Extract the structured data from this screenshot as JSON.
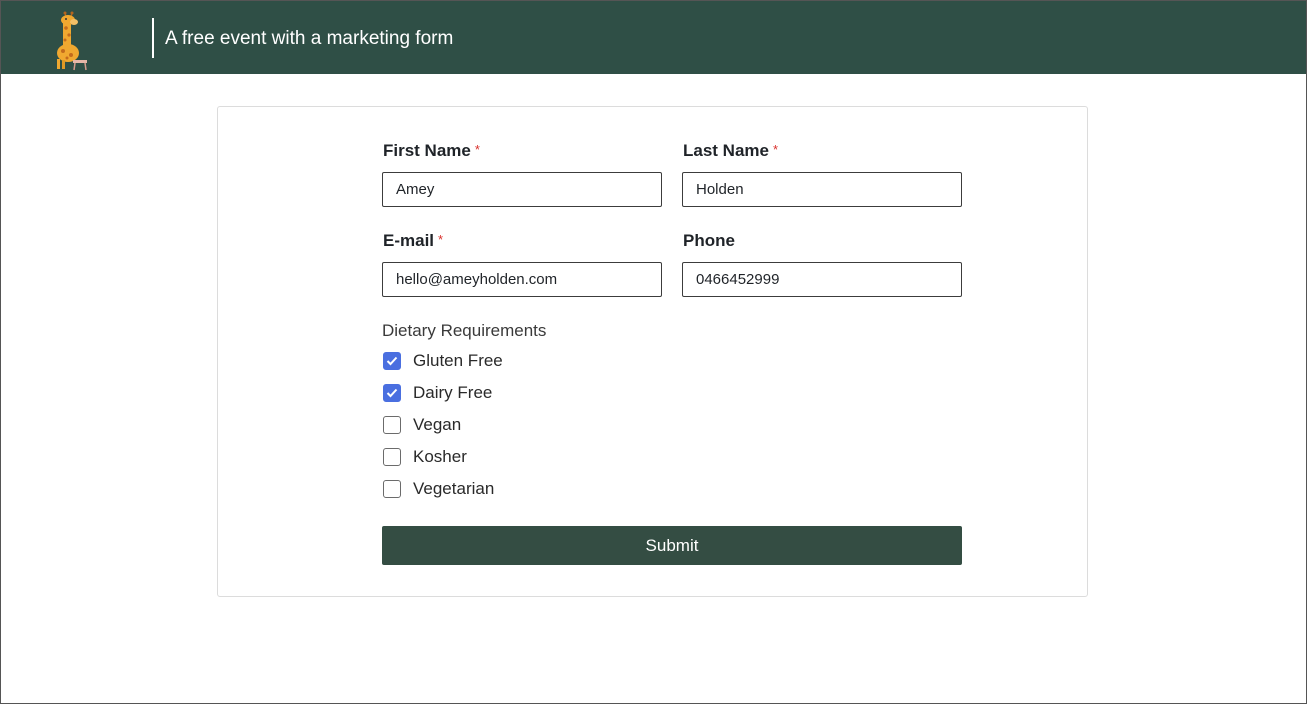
{
  "header": {
    "title": "A free event with a marketing form",
    "logo_icon": "giraffe-logo-icon"
  },
  "form": {
    "first_name": {
      "label": "First Name",
      "required_mark": "*",
      "value": "Amey"
    },
    "last_name": {
      "label": "Last Name",
      "required_mark": "*",
      "value": "Holden"
    },
    "email": {
      "label": "E-mail",
      "required_mark": "*",
      "value": "hello@ameyholden.com"
    },
    "phone": {
      "label": "Phone",
      "value": "0466452999"
    },
    "dietary": {
      "label": "Dietary Requirements",
      "options": [
        {
          "label": "Gluten Free",
          "checked": true
        },
        {
          "label": "Dairy Free",
          "checked": true
        },
        {
          "label": "Vegan",
          "checked": false
        },
        {
          "label": "Kosher",
          "checked": false
        },
        {
          "label": "Vegetarian",
          "checked": false
        }
      ]
    },
    "submit_label": "Submit"
  },
  "colors": {
    "header_bg": "#2f4f46",
    "button_bg": "#344d43",
    "checkbox_checked": "#4a6fe0",
    "required": "#d9302c"
  }
}
